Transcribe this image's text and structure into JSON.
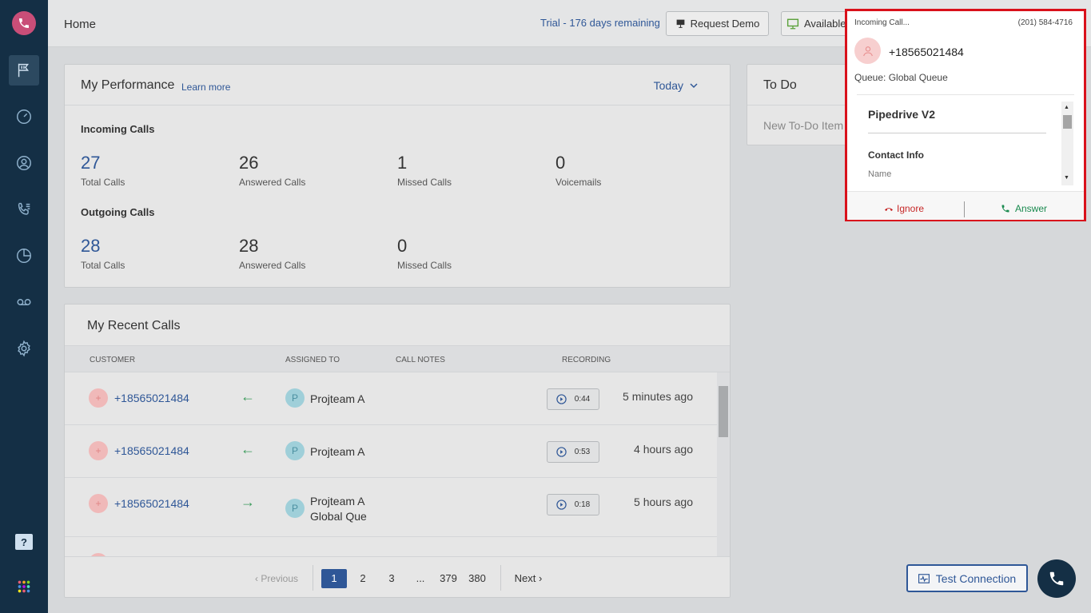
{
  "header": {
    "title": "Home",
    "trial": "Trial - 176 days remaining",
    "request_demo": "Request Demo",
    "status": "Available"
  },
  "sidebar": {
    "items": [
      {
        "icon": "flag-icon"
      },
      {
        "icon": "dashboard-icon"
      },
      {
        "icon": "contacts-icon"
      },
      {
        "icon": "call-log-icon"
      },
      {
        "icon": "analytics-icon"
      },
      {
        "icon": "voicemail-icon"
      },
      {
        "icon": "settings-icon"
      }
    ],
    "help_label": "?"
  },
  "performance": {
    "title": "My Performance",
    "learn_more": "Learn more",
    "period": "Today",
    "incoming_label": "Incoming Calls",
    "outgoing_label": "Outgoing Calls",
    "incoming": [
      {
        "value": "27",
        "label": "Total Calls"
      },
      {
        "value": "26",
        "label": "Answered Calls"
      },
      {
        "value": "1",
        "label": "Missed Calls"
      },
      {
        "value": "0",
        "label": "Voicemails"
      }
    ],
    "outgoing": [
      {
        "value": "28",
        "label": "Total Calls"
      },
      {
        "value": "28",
        "label": "Answered Calls"
      },
      {
        "value": "0",
        "label": "Missed Calls"
      }
    ]
  },
  "todo": {
    "title": "To Do",
    "new_item": "New To-Do Item"
  },
  "recent": {
    "title": "My Recent Calls",
    "columns": {
      "customer": "CUSTOMER",
      "assigned": "ASSIGNED TO",
      "notes": "CALL NOTES",
      "recording": "RECORDING"
    },
    "rows": [
      {
        "avatar": "+",
        "number": "+18565021484",
        "direction": "←",
        "assignee_initial": "P",
        "assignee": "Projteam A",
        "assignee2": "",
        "duration": "0:44",
        "time": "5 minutes ago"
      },
      {
        "avatar": "+",
        "number": "+18565021484",
        "direction": "←",
        "assignee_initial": "P",
        "assignee": "Projteam A",
        "assignee2": "",
        "duration": "0:53",
        "time": "4 hours ago"
      },
      {
        "avatar": "+",
        "number": "+18565021484",
        "direction": "→",
        "assignee_initial": "P",
        "assignee": "Projteam A",
        "assignee2": "Global Que",
        "duration": "0:18",
        "time": "5 hours ago"
      }
    ],
    "pager": {
      "prev": "‹ Previous",
      "pages": [
        "1",
        "2",
        "3",
        "...",
        "379",
        "380"
      ],
      "current": "1",
      "next": "Next ›"
    }
  },
  "popup": {
    "incoming_label": "Incoming Call...",
    "own_number": "(201) 584-4716",
    "caller": "+18565021484",
    "queue": "Queue: Global Queue",
    "crm": "Pipedrive V2",
    "contact_info": "Contact Info",
    "name_label": "Name",
    "ignore": "Ignore",
    "answer": "Answer"
  },
  "footer": {
    "test_connection": "Test Connection"
  },
  "colors": {
    "sidebar": "#142f45",
    "accent": "#2f5797",
    "logo": "#c94e78",
    "popup_border": "#d9111b",
    "answer": "#1a8a4f",
    "ignore": "#c62828"
  }
}
